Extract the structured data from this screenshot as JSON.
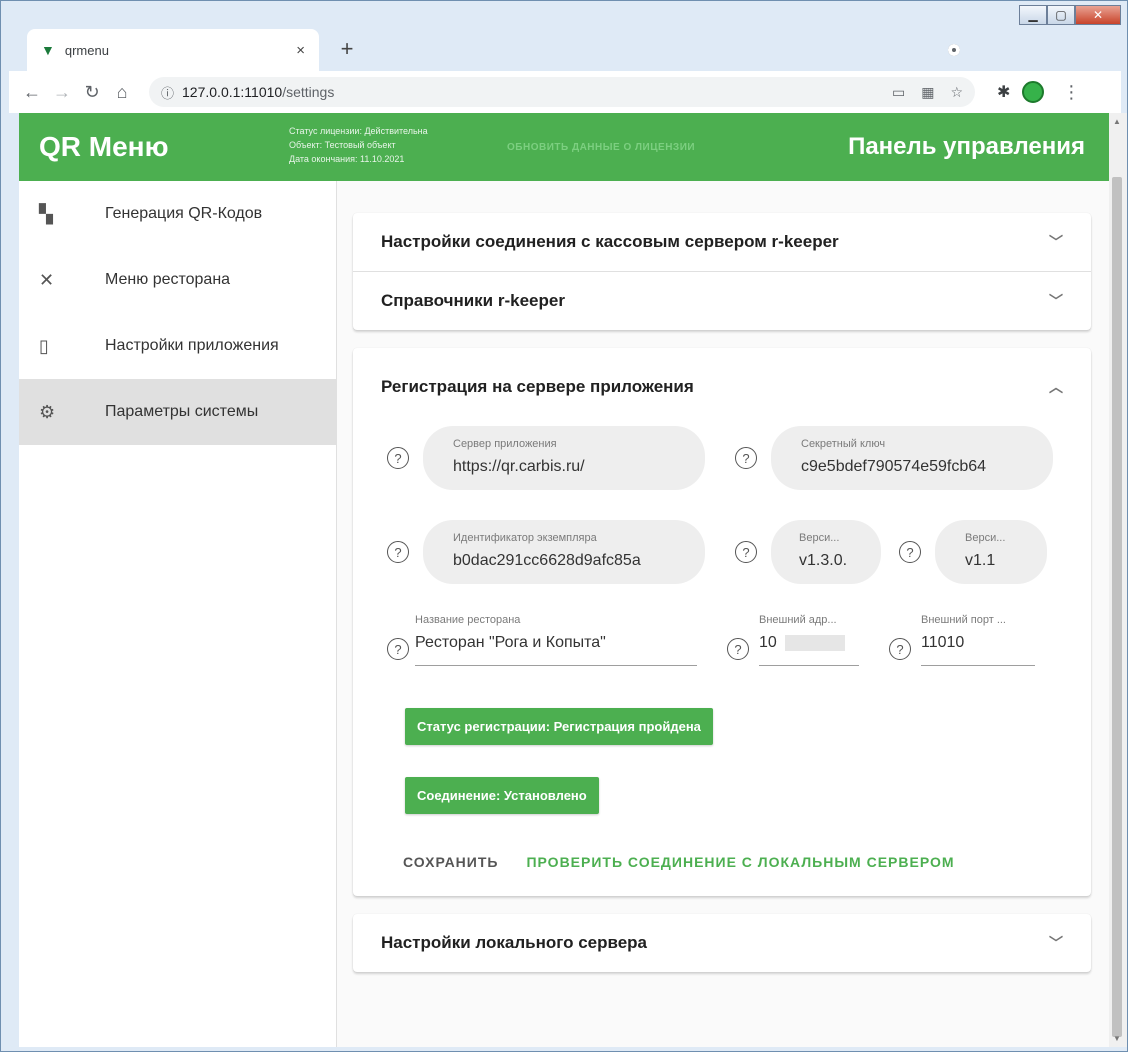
{
  "browser": {
    "tab_title": "qrmenu",
    "tab_close": "×",
    "new_tab": "+",
    "url_host": "127.0.0.1:11010",
    "url_path": "/settings"
  },
  "app": {
    "title": "QR Меню",
    "license_status": "Статус лицензии: Действительна",
    "license_object": "Объект: Тестовый объект",
    "license_expiry": "Дата окончания: 11.10.2021",
    "license_refresh": "обновить данные о лицензии",
    "panel_title": "Панель управления",
    "accent_color": "#4caf50"
  },
  "sidebar": {
    "items": [
      {
        "label": "Генерация QR-Кодов",
        "icon": "qr-code-icon"
      },
      {
        "label": "Меню ресторана",
        "icon": "fork-knife-icon"
      },
      {
        "label": "Настройки приложения",
        "icon": "phone-settings-icon"
      },
      {
        "label": "Параметры системы",
        "icon": "gear-icon",
        "active": true
      }
    ]
  },
  "panels": {
    "connection": "Настройки соединения с кассовым сервером r-keeper",
    "directories": "Справочники r-keeper",
    "registration": "Регистрация на сервере приложения",
    "local_server": "Настройки локального сервера"
  },
  "registration": {
    "server_label": "Сервер приложения",
    "server_value": "https://qr.carbis.ru/",
    "secret_label": "Секретный ключ",
    "secret_value": "c9e5bdef790574e59fcb64",
    "instance_label": "Идентификатор экземпляра",
    "instance_value": "b0dac291cc6628d9afc85a",
    "version1_label": "Верси...",
    "version1_value": "v1.3.0.",
    "version2_label": "Верси...",
    "version2_value": "v1.1",
    "restaurant_label": "Название ресторана",
    "restaurant_value": "Ресторан \"Рога и Копыта\"",
    "ext_address_label": "Внешний адр...",
    "ext_address_value": "10",
    "ext_port_label": "Внешний порт ...",
    "ext_port_value": "11010",
    "status_registration": "Статус регистрации: Регистрация пройдена",
    "status_connection": "Соединение: Установлено",
    "save_button": "Сохранить",
    "check_button": "Проверить соединение с локальным сервером"
  }
}
